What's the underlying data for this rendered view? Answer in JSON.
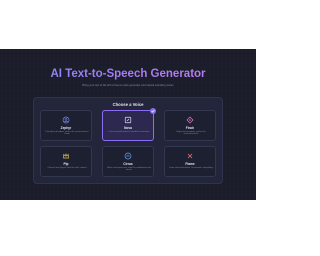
{
  "header": {
    "title": "AI Text-to-Speech Generator",
    "subtitle": "Bring your text to life with a free-to-voice generator and natural sounding voices"
  },
  "voice_panel": {
    "title": "Choose a Voice",
    "selected_voice": "Nova",
    "voices": [
      {
        "name": "Zephyr",
        "description": "Friendly and upbeat, perfect for conversational reads",
        "icon": "user-circle-icon",
        "color": "#7a80e6",
        "selected": false
      },
      {
        "name": "Nova",
        "description": "Calm and professional, suitable for narration",
        "icon": "square-pen-icon",
        "color": "#d9dcef",
        "selected": true
      },
      {
        "name": "Finch",
        "description": "Bright and energetic, perfect for announcements",
        "icon": "diamond-icon",
        "color": "#e678c8",
        "selected": false
      },
      {
        "name": "Pip",
        "description": "Cheerful and playful, ideal for kids' content",
        "icon": "crown-icon",
        "color": "#e6c25a",
        "selected": false
      },
      {
        "name": "Cirrus",
        "description": "Warm and expressive, ideal for audiobooks and stories",
        "icon": "cloud-circle-icon",
        "color": "#6a9ce8",
        "selected": false
      },
      {
        "name": "Flame",
        "description": "Deep and authoritative, for dramatic storytelling",
        "icon": "x-mark-icon",
        "color": "#e87373",
        "selected": false
      }
    ]
  },
  "colors": {
    "background": "#1b1d2b",
    "panel": "#23263a",
    "accent": "#8b6cf2"
  }
}
